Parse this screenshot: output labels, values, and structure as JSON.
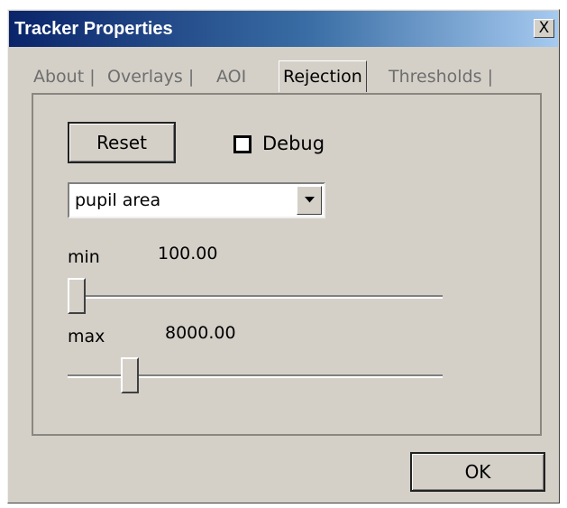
{
  "window": {
    "title": "Tracker Properties",
    "close_glyph": "X",
    "close_icon": "close-icon"
  },
  "tabs": [
    {
      "label": "About",
      "sep": "|"
    },
    {
      "label": "Overlays",
      "sep": "|"
    },
    {
      "label": "AOI",
      "sep": ""
    },
    {
      "label": "Rejection",
      "sep": "|",
      "active": true
    },
    {
      "label": "Thresholds",
      "sep": "|"
    }
  ],
  "rejection": {
    "reset_label": "Reset",
    "debug_label": "Debug",
    "debug_checked": false,
    "measure_select": {
      "value": "pupil area",
      "arrow_icon": "dropdown-arrow-icon"
    },
    "min": {
      "label": "min",
      "value_text": "100.00",
      "slider_position": 0.0
    },
    "max": {
      "label": "max",
      "value_text": "8000.00",
      "slider_position": 0.15
    }
  },
  "footer": {
    "ok_label": "OK"
  },
  "colors": {
    "face": "#d4d0c8",
    "title_start": "#0a246a",
    "title_end": "#a6caf0"
  }
}
